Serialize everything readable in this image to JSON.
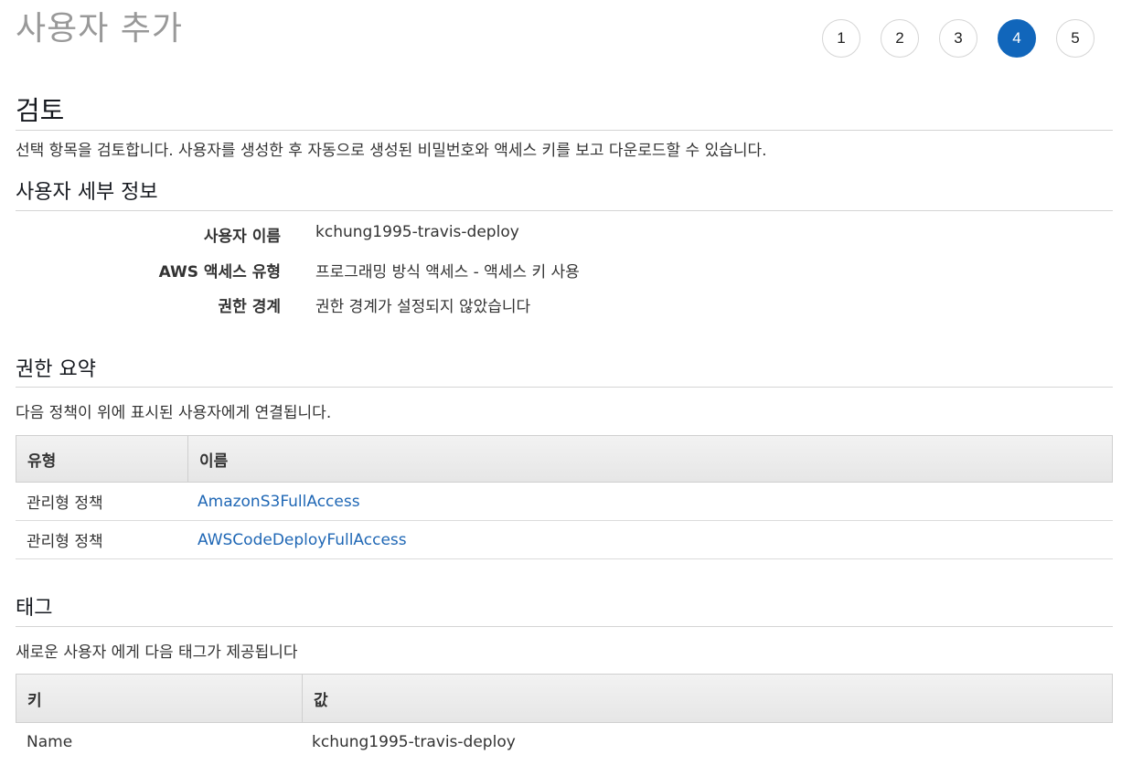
{
  "header": {
    "title": "사용자 추가",
    "steps": [
      "1",
      "2",
      "3",
      "4",
      "5"
    ],
    "active_step": "4"
  },
  "review": {
    "heading": "검토",
    "description": "선택 항목을 검토합니다. 사용자를 생성한 후 자동으로 생성된 비밀번호와 액세스 키를 보고 다운로드할 수 있습니다."
  },
  "user_details": {
    "heading": "사용자 세부 정보",
    "rows": [
      {
        "label": "사용자 이름",
        "value": "kchung1995-travis-deploy"
      },
      {
        "label": "AWS 액세스 유형",
        "value": "프로그래밍 방식 액세스 - 액세스 키 사용"
      },
      {
        "label": "권한 경계",
        "value": "권한 경계가 설정되지 않았습니다"
      }
    ]
  },
  "permissions": {
    "heading": "권한 요약",
    "description": "다음 정책이 위에 표시된 사용자에게 연결됩니다.",
    "columns": [
      "유형",
      "이름"
    ],
    "rows": [
      {
        "type": "관리형 정책",
        "name": "AmazonS3FullAccess"
      },
      {
        "type": "관리형 정책",
        "name": "AWSCodeDeployFullAccess"
      }
    ]
  },
  "tags": {
    "heading": "태그",
    "description": "새로운 사용자 에게 다음 태그가 제공됩니다",
    "columns": [
      "키",
      "값"
    ],
    "rows": [
      {
        "key": "Name",
        "value": "kchung1995-travis-deploy"
      }
    ]
  },
  "colors": {
    "active_step": "#1166bb",
    "link": "#1f67b5",
    "title": "#999999"
  }
}
